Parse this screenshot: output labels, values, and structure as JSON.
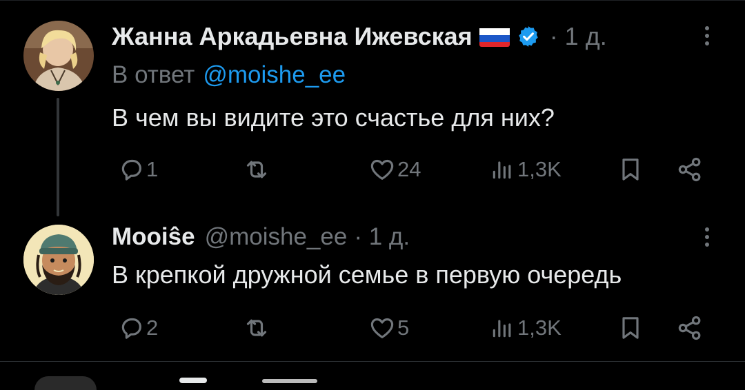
{
  "tweet1": {
    "author": "Жанна Аркадьевна Ижевская",
    "flag": "russia-flag",
    "verified_icon": "verified-badge-icon",
    "time": "· 1 д.",
    "reply_prefix": "В ответ",
    "reply_handle": "@moishe_ee",
    "text": "В чем вы видите это счастье для них?",
    "replies": "1",
    "likes": "24",
    "views": "1,3K"
  },
  "tweet2": {
    "author": "Mooiŝe",
    "handle": "@moishe_ee",
    "time": "· 1 д.",
    "text": "В крепкой дружной семье в первую очередь",
    "replies": "2",
    "likes": "5",
    "views": "1,3K"
  },
  "colors": {
    "background": "#000000",
    "text": "#e7e9ea",
    "muted": "#71767b",
    "link": "#1d9bf0",
    "verified": "#1d9bf0"
  }
}
